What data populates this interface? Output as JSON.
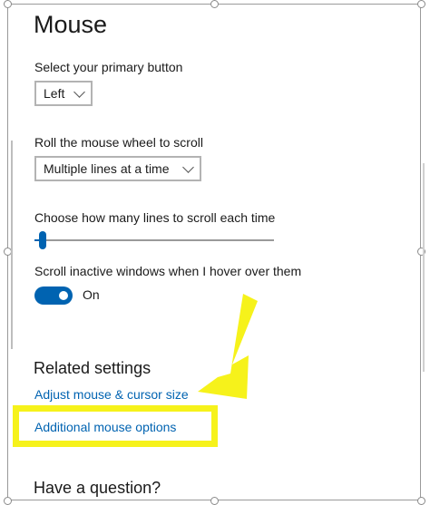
{
  "settings": {
    "title": "Mouse",
    "primary_button": {
      "label": "Select your primary button",
      "value": "Left"
    },
    "scroll_mode": {
      "label": "Roll the mouse wheel to scroll",
      "value": "Multiple lines at a time"
    },
    "lines_to_scroll": {
      "label": "Choose how many lines to scroll each time",
      "value": 0.02
    },
    "inactive_scroll": {
      "label": "Scroll inactive windows when I hover over them",
      "state": "On"
    }
  },
  "related": {
    "heading": "Related settings",
    "links": [
      "Adjust mouse & cursor size",
      "Additional mouse options"
    ]
  },
  "help": {
    "heading": "Have a question?"
  },
  "colors": {
    "accent": "#0063b1",
    "annotation": "#f6f21b"
  },
  "annotation": {
    "icon": "arrow-icon"
  }
}
